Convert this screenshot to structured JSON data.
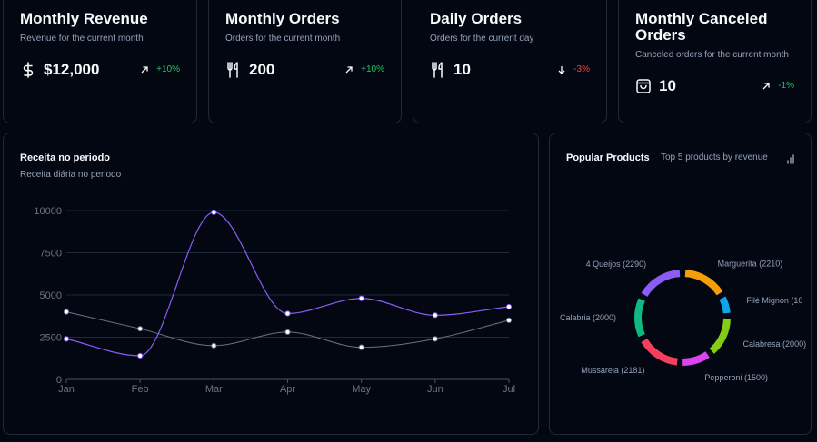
{
  "kpis": [
    {
      "title": "Monthly Revenue",
      "subtitle": "Revenue for the current month",
      "icon": "dollar-icon",
      "value": "$12,000",
      "delta": "+10%",
      "trend": "up"
    },
    {
      "title": "Monthly Orders",
      "subtitle": "Orders for the current month",
      "icon": "utensils-icon",
      "value": "200",
      "delta": "+10%",
      "trend": "up"
    },
    {
      "title": "Daily Orders",
      "subtitle": "Orders for the current day",
      "icon": "utensils-icon",
      "value": "10",
      "delta": "-3%",
      "trend": "down"
    },
    {
      "title": "Monthly Canceled Orders",
      "subtitle": "Canceled orders for the current month",
      "icon": "shopping-bag-icon",
      "value": "10",
      "delta": "-1%",
      "trend": "up"
    }
  ],
  "revenue": {
    "title": "Receita no periodo",
    "subtitle": "Receita diária no periodo"
  },
  "popular": {
    "title": "Popular Products",
    "subtitle": "Top 5 products by revenue",
    "icon": "bar-chart-icon"
  },
  "colors": {
    "positive": "#22c55e",
    "negative": "#ef4444",
    "line_primary": "#8b5cf6",
    "line_secondary": "#64748b"
  },
  "chart_data": [
    {
      "type": "line",
      "x": [
        "Jan",
        "Feb",
        "Mar",
        "Apr",
        "May",
        "Jun",
        "Jul"
      ],
      "ylim": [
        0,
        10000
      ],
      "yticks": [
        0,
        2500,
        5000,
        7500,
        10000
      ],
      "series": [
        {
          "values": [
            2400,
            1400,
            9900,
            3900,
            4800,
            3800,
            4300
          ],
          "color": "#8b5cf6"
        },
        {
          "values": [
            4000,
            3000,
            2000,
            2800,
            1900,
            2400,
            3500
          ],
          "color": "#64748b"
        }
      ],
      "grid": true
    },
    {
      "type": "pie",
      "labels": [
        "Marguerita (2210)",
        "Filé Mignon (10",
        "Calabresa (2000)",
        "Pepperoni (1500)",
        "Mussarela (2181)",
        "Calabria (2000)",
        "4 Queijos (2290)"
      ],
      "values": [
        2210,
        1000,
        2000,
        1500,
        2181,
        2000,
        2290
      ],
      "colors": [
        "#f59e0b",
        "#0ea5e9",
        "#84cc16",
        "#d946ef",
        "#f43f5e",
        "#10b981",
        "#8b5cf6"
      ]
    }
  ]
}
